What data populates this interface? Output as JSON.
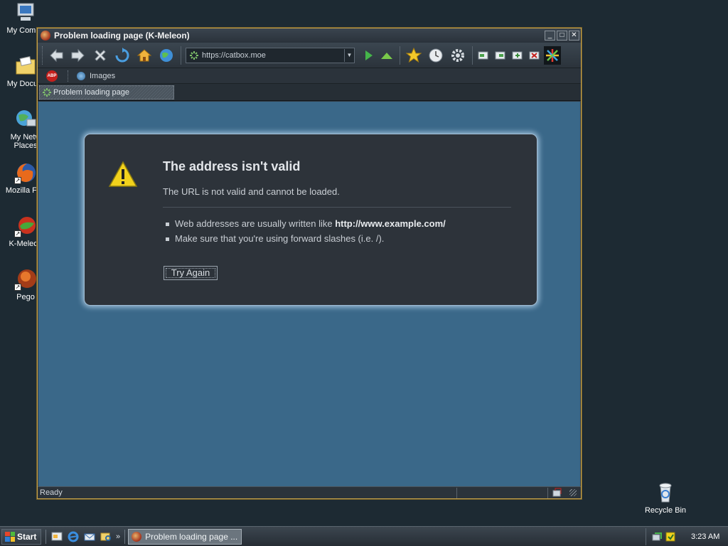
{
  "desktop": {
    "icons": [
      {
        "label": "My Compu",
        "icon": "computer-icon"
      },
      {
        "label": "My Docum",
        "icon": "folder-icon"
      },
      {
        "label": "My Netw",
        "label2": "Places",
        "icon": "network-icon"
      },
      {
        "label": "Mozilla Fire",
        "icon": "firefox-icon"
      },
      {
        "label": "K-Meleon",
        "icon": "kmeleon-icon"
      },
      {
        "label": "Pego",
        "icon": "pego-icon"
      },
      {
        "label": "Recycle Bin",
        "icon": "recycle-bin-icon"
      }
    ]
  },
  "window": {
    "title": "Problem loading page (K-Meleon)",
    "controls": {
      "minimize": "_",
      "maximize": "□",
      "close": "✕"
    }
  },
  "toolbar": {
    "url": "https://catbox.moe",
    "url_dropdown": "▼"
  },
  "bookmarks": {
    "items": [
      {
        "label": "Images"
      }
    ]
  },
  "tabs": [
    {
      "label": "Problem loading page",
      "active": true
    }
  ],
  "error": {
    "title": "The address isn't valid",
    "subtitle": "The URL is not valid and cannot be loaded.",
    "bullet1_prefix": "Web addresses are usually written like ",
    "bullet1_bold": "http://www.example.com/",
    "bullet2": "Make sure that you're using forward slashes (i.e. /).",
    "button": "Try Again"
  },
  "status": {
    "text": "Ready"
  },
  "taskbar": {
    "start": "Start",
    "more": "»",
    "task_label": "Problem loading page ...",
    "clock": "3:23 AM"
  },
  "colors": {
    "desktop": "#1d2a33",
    "content_bg": "#3a6889",
    "error_box": "#2d333a",
    "glow": "#b4d2eb",
    "window_border": "#c9a44a"
  }
}
